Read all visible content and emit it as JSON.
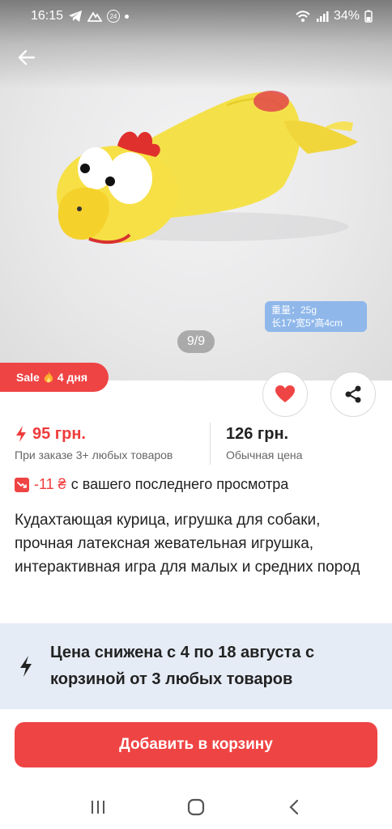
{
  "status": {
    "time": "16:15",
    "badge": "24",
    "battery": "34%"
  },
  "image": {
    "pager": "9/9",
    "weight_line1": "重量：25g",
    "weight_line2": "长17*宽5*高4cm"
  },
  "sale": {
    "label": "Sale",
    "days": "4 дня"
  },
  "price": {
    "bundle_price": "95 грн.",
    "bundle_caption": "При заказе 3+ любых товаров",
    "regular_price": "126 грн.",
    "regular_caption": "Обычная цена"
  },
  "drop": {
    "amount": "-11 ₴",
    "text": "с вашего последнего просмотра"
  },
  "product": {
    "title": "Кудахтающая курица, игрушка для собаки, прочная латексная жевательная игрушка, интерактивная игра для малых и средних пород"
  },
  "promo": {
    "text": "Цена снижена с 4 по 18 августа с корзиной от 3 любых товаров"
  },
  "cart": {
    "label": "Добавить в корзину"
  },
  "colors": {
    "accent": "#ef4444",
    "promo_bg": "#e6ecf6"
  },
  "icons": {
    "back": "arrow-left-icon",
    "favorite": "heart-icon",
    "share": "share-icon",
    "sale": "fire-icon",
    "lightning": "lightning-icon"
  }
}
